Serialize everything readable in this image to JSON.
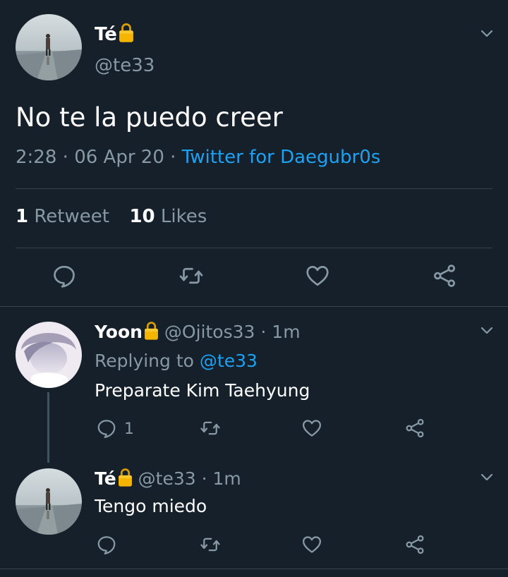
{
  "main_tweet": {
    "name": "Té",
    "handle": "@te33",
    "text": "No te la puedo creer",
    "time": "2:28",
    "sep1": "·",
    "date": "06 Apr 20",
    "sep2": "·",
    "source": "Twitter for Daegubr0s",
    "retweets_count": "1",
    "retweets_label": "Retweet",
    "likes_count": "10",
    "likes_label": "Likes"
  },
  "replies": [
    {
      "name": "Yoon",
      "handle": "@Ojitos33",
      "sep": "·",
      "age": "1m",
      "replying_label": "Replying to",
      "replying_to": "@te33",
      "text": "Preparate Kim Taehyung",
      "reply_count": "1"
    },
    {
      "name": "Té",
      "handle": "@te33",
      "sep": "·",
      "age": "1m",
      "text": "Tengo miedo"
    }
  ],
  "icons": [
    "avatar",
    "lock-icon",
    "chevron-down-icon",
    "reply-icon",
    "retweet-icon",
    "like-icon",
    "share-icon"
  ],
  "colors": {
    "background": "#15202b",
    "text": "#ffffff",
    "muted": "#8899a6",
    "link": "#1da1f2",
    "divider": "#38444d",
    "lock": "#f4b400"
  }
}
